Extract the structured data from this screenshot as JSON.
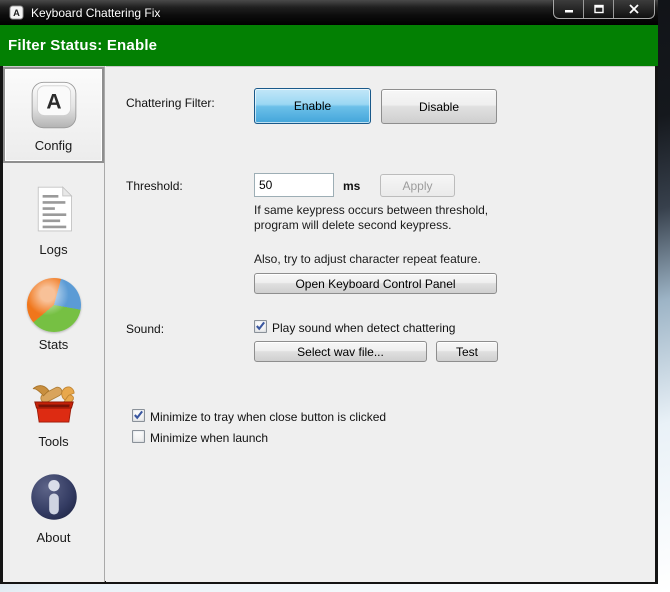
{
  "window": {
    "title": "Keyboard Chattering Fix",
    "controls": {
      "minimize": "minimize",
      "maximize": "maximize",
      "close": "close"
    }
  },
  "status_bar": {
    "text": "Filter Status: Enable",
    "background_color": "#038003"
  },
  "sidebar": {
    "items": [
      {
        "label": "Config",
        "icon": "keyboard-key-icon",
        "selected": true
      },
      {
        "label": "Logs",
        "icon": "document-icon",
        "selected": false
      },
      {
        "label": "Stats",
        "icon": "pie-chart-icon",
        "selected": false
      },
      {
        "label": "Tools",
        "icon": "toolbox-icon",
        "selected": false
      },
      {
        "label": "About",
        "icon": "info-icon",
        "selected": false
      }
    ]
  },
  "main": {
    "chattering_filter": {
      "label": "Chattering Filter:",
      "enable_label": "Enable",
      "disable_label": "Disable",
      "enable_active": true,
      "active_button_color": "#43a5da"
    },
    "threshold": {
      "label": "Threshold:",
      "value": "50",
      "unit": "ms",
      "apply_label": "Apply",
      "apply_disabled": true,
      "help_line1": "If same keypress occurs between threshold,",
      "help_line2": "program will delete second keypress.",
      "repeat_hint": "Also, try to adjust character repeat feature.",
      "control_panel_label": "Open Keyboard Control Panel"
    },
    "sound": {
      "label": "Sound:",
      "play_checkbox": {
        "label": "Play sound when detect chattering",
        "checked": true
      },
      "select_wav_label": "Select wav file...",
      "test_label": "Test"
    },
    "options": [
      {
        "label": "Minimize to tray when close button is clicked",
        "checked": true
      },
      {
        "label": "Minimize when launch",
        "checked": false
      }
    ]
  }
}
